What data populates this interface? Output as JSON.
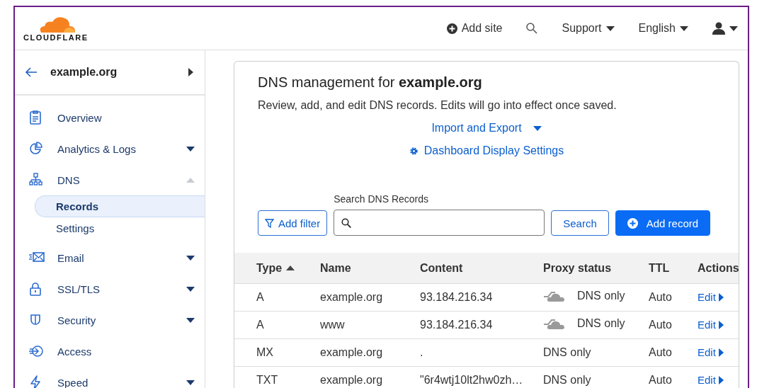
{
  "header": {
    "logo": "CLOUDFLARE",
    "actions": [
      {
        "kind": "add",
        "label": "Add site"
      },
      {
        "kind": "search"
      },
      {
        "kind": "menu",
        "label": "Support"
      },
      {
        "kind": "menu",
        "label": "English"
      },
      {
        "kind": "user"
      }
    ]
  },
  "sidebar": {
    "site": "example.org",
    "items": [
      {
        "label": "Overview"
      },
      {
        "label": "Analytics & Logs",
        "expanded": false
      },
      {
        "label": "DNS",
        "expanded": true,
        "children": [
          {
            "label": "Records",
            "selected": true
          },
          {
            "label": "Settings",
            "selected": false
          }
        ]
      },
      {
        "label": "Email",
        "expanded": false
      },
      {
        "label": "SSL/TLS",
        "expanded": false
      },
      {
        "label": "Security",
        "expanded": false
      },
      {
        "label": "Access"
      },
      {
        "label": "Speed",
        "expanded": false
      }
    ]
  },
  "main": {
    "title": "DNS management for **example.org**",
    "description": "Review, add, and edit DNS records. Edits will go into effect once saved.",
    "links": [
      {
        "kind": "dropdown",
        "label": "Import and Export"
      },
      {
        "kind": "settings",
        "label": "Dashboard Display Settings"
      }
    ],
    "search": {
      "label": "Search DNS Records",
      "filter_button": "Add filter",
      "search_button": "Search",
      "add_button": "Add record"
    },
    "table": {
      "columns": [
        {
          "label": "Type",
          "sorted": true
        },
        {
          "label": "Name",
          "sorted": false
        },
        {
          "label": "Content",
          "sorted": false
        },
        {
          "label": "Proxy status",
          "sorted": false
        },
        {
          "label": "TTL",
          "sorted": false
        },
        {
          "label": "Actions",
          "sorted": false
        }
      ],
      "rows": [
        {
          "type": "A",
          "name": "example.org",
          "content": "93.184.216.34",
          "proxy_cloud": true,
          "proxy": "DNS only",
          "ttl": "Auto",
          "action": "Edit"
        },
        {
          "type": "A",
          "name": "www",
          "content": "93.184.216.34",
          "proxy_cloud": true,
          "proxy": "DNS only",
          "ttl": "Auto",
          "action": "Edit"
        },
        {
          "type": "MX",
          "name": "example.org",
          "content": ".",
          "proxy_cloud": false,
          "proxy": "DNS only",
          "ttl": "Auto",
          "action": "Edit"
        },
        {
          "type": "TXT",
          "name": "example.org",
          "content": "\"6r4wtj10lt2hw0zh…",
          "proxy_cloud": false,
          "proxy": "DNS only",
          "ttl": "Auto",
          "action": "Edit"
        }
      ]
    }
  }
}
